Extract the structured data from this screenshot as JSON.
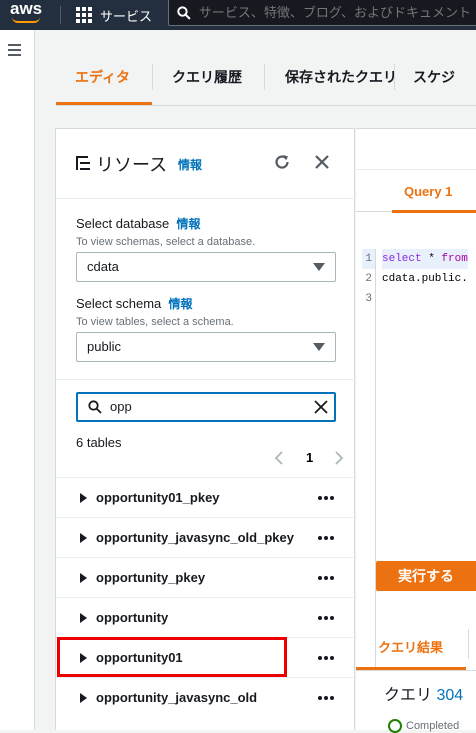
{
  "topbar": {
    "logo": "aws",
    "services_label": "サービス",
    "search_placeholder": "サービス、特徴、ブログ、およびドキュメント"
  },
  "tabs": [
    {
      "label": "エディタ",
      "active": true
    },
    {
      "label": "クエリ履歴",
      "active": false
    },
    {
      "label": "保存されたクエリ",
      "active": false
    },
    {
      "label": "スケジ",
      "active": false
    }
  ],
  "resources": {
    "title": "リソース",
    "info": "情報",
    "select_database": {
      "label": "Select database",
      "info": "情報",
      "hint": "To view schemas, select a database.",
      "value": "cdata"
    },
    "select_schema": {
      "label": "Select schema",
      "info": "情報",
      "hint": "To view tables, select a schema.",
      "value": "public"
    },
    "filter": {
      "value": "opp"
    },
    "count_label": "6 tables",
    "page_number": "1",
    "tables": [
      {
        "name": "opportunity01_pkey"
      },
      {
        "name": "opportunity_javasync_old_pkey"
      },
      {
        "name": "opportunity_pkey"
      },
      {
        "name": "opportunity"
      },
      {
        "name": "opportunity01"
      },
      {
        "name": "opportunity_javasync_old"
      }
    ]
  },
  "editor": {
    "tab_label": "Query 1",
    "line_numbers": [
      "1",
      "2",
      "3"
    ],
    "line1_kw1": "select",
    "line1_rest": " * ",
    "line1_kw2": "from",
    "line2": "cdata.public.",
    "run_label": "実行する",
    "results_tab": "クエリ結果",
    "query_id_prefix": "クエリ ",
    "query_id": "304",
    "status": "Completed"
  },
  "colors": {
    "accent": "#ec7211",
    "link": "#0073bb",
    "highlight": "#e00000",
    "topbar": "#232f3e"
  }
}
